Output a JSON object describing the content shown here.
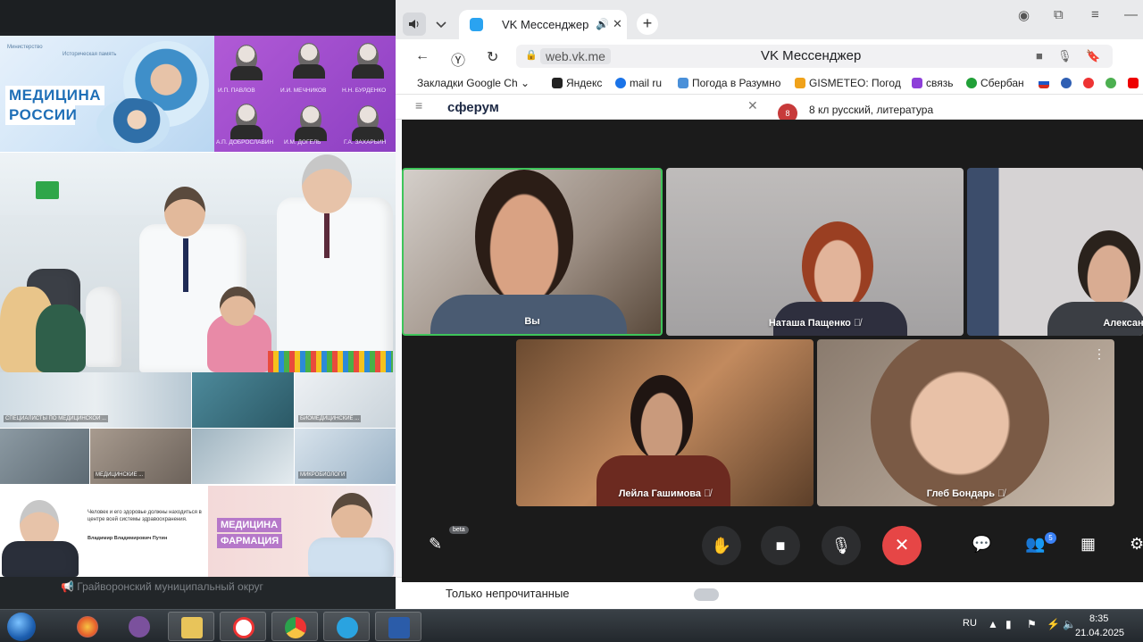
{
  "slide": {
    "banner_title_1": "МЕДИЦИНА",
    "banner_title_2": "РОССИИ",
    "banner_logo_1": "Министерство",
    "banner_logo_2": "Историческая память",
    "scientists": [
      {
        "name": "И.П. ПАВЛОВ"
      },
      {
        "name": "И.И. МЕЧНИКОВ"
      },
      {
        "name": "Н.Н. БУРДЕНКО"
      },
      {
        "name": "А.П. ДОБРОСЛАВИН"
      },
      {
        "name": "И.М. ДОГЕЛЬ"
      },
      {
        "name": "Г.А. ЗАХАРЬИН"
      }
    ],
    "grid_captions": [
      "СПЕЦИАЛИСТЫ ПО МЕДИЦИНСКОЙ ...",
      "",
      "БИОМЕДИЦИНСКИЕ ...",
      "",
      "МЕДИЦИНСКИЕ ...",
      "",
      "МИКРОБИОЛОГИ"
    ],
    "quote_text": "Человек и его здоровье должны находиться в центре всей системы здравоохранения.",
    "quote_author": "Владимир Владимирович Путин",
    "pharm_line1": "МЕДИЦИНА",
    "pharm_line2": "ФАРМАЦИЯ",
    "underlay_text": "📢 Грайворонский муниципальный округ"
  },
  "browser": {
    "tab_title": "VK Мессенджер",
    "url_host": "web.vk.me",
    "page_title": "VK Мессенджер",
    "bookmarks": [
      {
        "label": "Закладки Google Ch",
        "color": "#ffffff"
      },
      {
        "label": "Яндекс",
        "color": "#222222"
      },
      {
        "label": "mail ru",
        "color": "#1a73e8"
      },
      {
        "label": "Погода в Разумно",
        "color": "#4a90d9"
      },
      {
        "label": "GISMETEO: Погод",
        "color": "#f0a21a"
      },
      {
        "label": "связь",
        "color": "#8e3fd9"
      },
      {
        "label": "Сбербан",
        "color": "#21a038"
      }
    ]
  },
  "vk": {
    "brand": "сферум",
    "chat_avatar": "8",
    "chat_title": "8 кл русский, литература",
    "filter_label": "Только непрочитанные"
  },
  "call": {
    "participants": [
      {
        "name": "Вы"
      },
      {
        "name": "Наташа Пащенко"
      },
      {
        "name": "Александр Зуен"
      },
      {
        "name": "Лейла Гашимова"
      },
      {
        "name": "Глеб Бондарь"
      }
    ],
    "beta_label": "beta",
    "participants_count": "5",
    "colors": {
      "end_call": "#e64646",
      "speaking_border": "#3ec45a"
    }
  },
  "taskbar": {
    "lang": "RU",
    "time": "8:35",
    "date": "21.04.2025"
  }
}
